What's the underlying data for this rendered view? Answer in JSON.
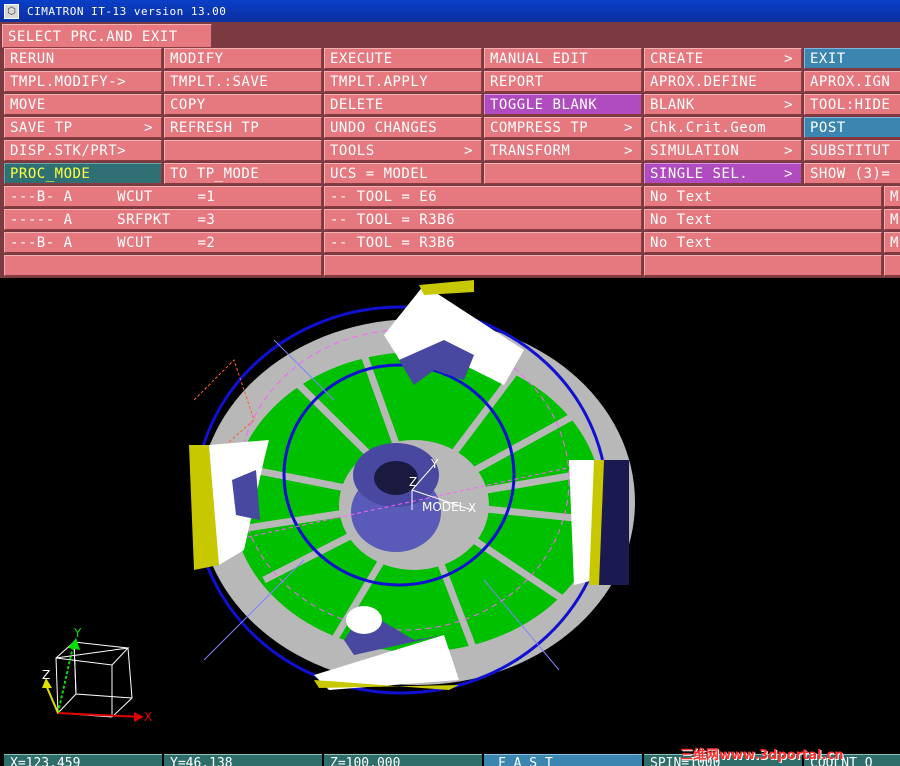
{
  "window": {
    "title": "CIMATRON IT-13 version 13.00",
    "icon": "cimatron-app-icon"
  },
  "header": {
    "select_label": "SELECT PRC.AND EXIT"
  },
  "menu": {
    "row1": [
      "RERUN",
      "MODIFY",
      "EXECUTE",
      "MANUAL EDIT",
      "CREATE",
      "EXIT"
    ],
    "row2": [
      "TMPL.MODIFY->",
      "TMPLT.:SAVE",
      "TMPLT.APPLY",
      "REPORT",
      "APROX.DEFINE",
      "APROX.IGN"
    ],
    "row3": [
      "MOVE",
      "COPY",
      "DELETE",
      "TOGGLE BLANK",
      "BLANK",
      "TOOL:HIDE"
    ],
    "row4": [
      "SAVE TP",
      "REFRESH TP",
      "UNDO CHANGES",
      "COMPRESS TP",
      "Chk.Crit.Geom",
      "POST"
    ],
    "row5": [
      "DISP.STK/PRT>",
      "",
      "TOOLS",
      "TRANSFORM",
      "SIMULATION",
      "SUBSTITUT"
    ],
    "row6": [
      "PROC_MODE",
      "TO TP_MODE",
      "UCS = MODEL",
      "",
      "SINGLE SEL.",
      "SHOW (3)="
    ],
    "arrow": ">"
  },
  "procedures": [
    {
      "name": "---B- A     WCUT     =1",
      "tool": "-- TOOL = E6",
      "text": "No Text",
      "extra": "M"
    },
    {
      "name": "----- A     SRFPKT   =3",
      "tool": "-- TOOL = R3B6",
      "text": "No Text",
      "extra": "M"
    },
    {
      "name": "---B- A     WCUT     =2",
      "tool": "-- TOOL = R3B6",
      "text": "No Text",
      "extra": "M"
    }
  ],
  "viewport": {
    "model_label": "MODEL",
    "axis_x": "X",
    "axis_y": "Y",
    "axis_z": "Z",
    "colors": {
      "stock": "#b8b8b8",
      "toolpath": "#00c000",
      "part": "#5a5ab8",
      "circle": "#1010d0",
      "clamp": "#c8c800"
    }
  },
  "status": {
    "x": "X=123.459",
    "y": "Y=46.138",
    "z": "Z=100.000",
    "mode": "F A S T",
    "spin": "SPIN=1000",
    "coolant": "COOLNT O"
  },
  "watermark": "三维网www.3dportal.cn"
}
